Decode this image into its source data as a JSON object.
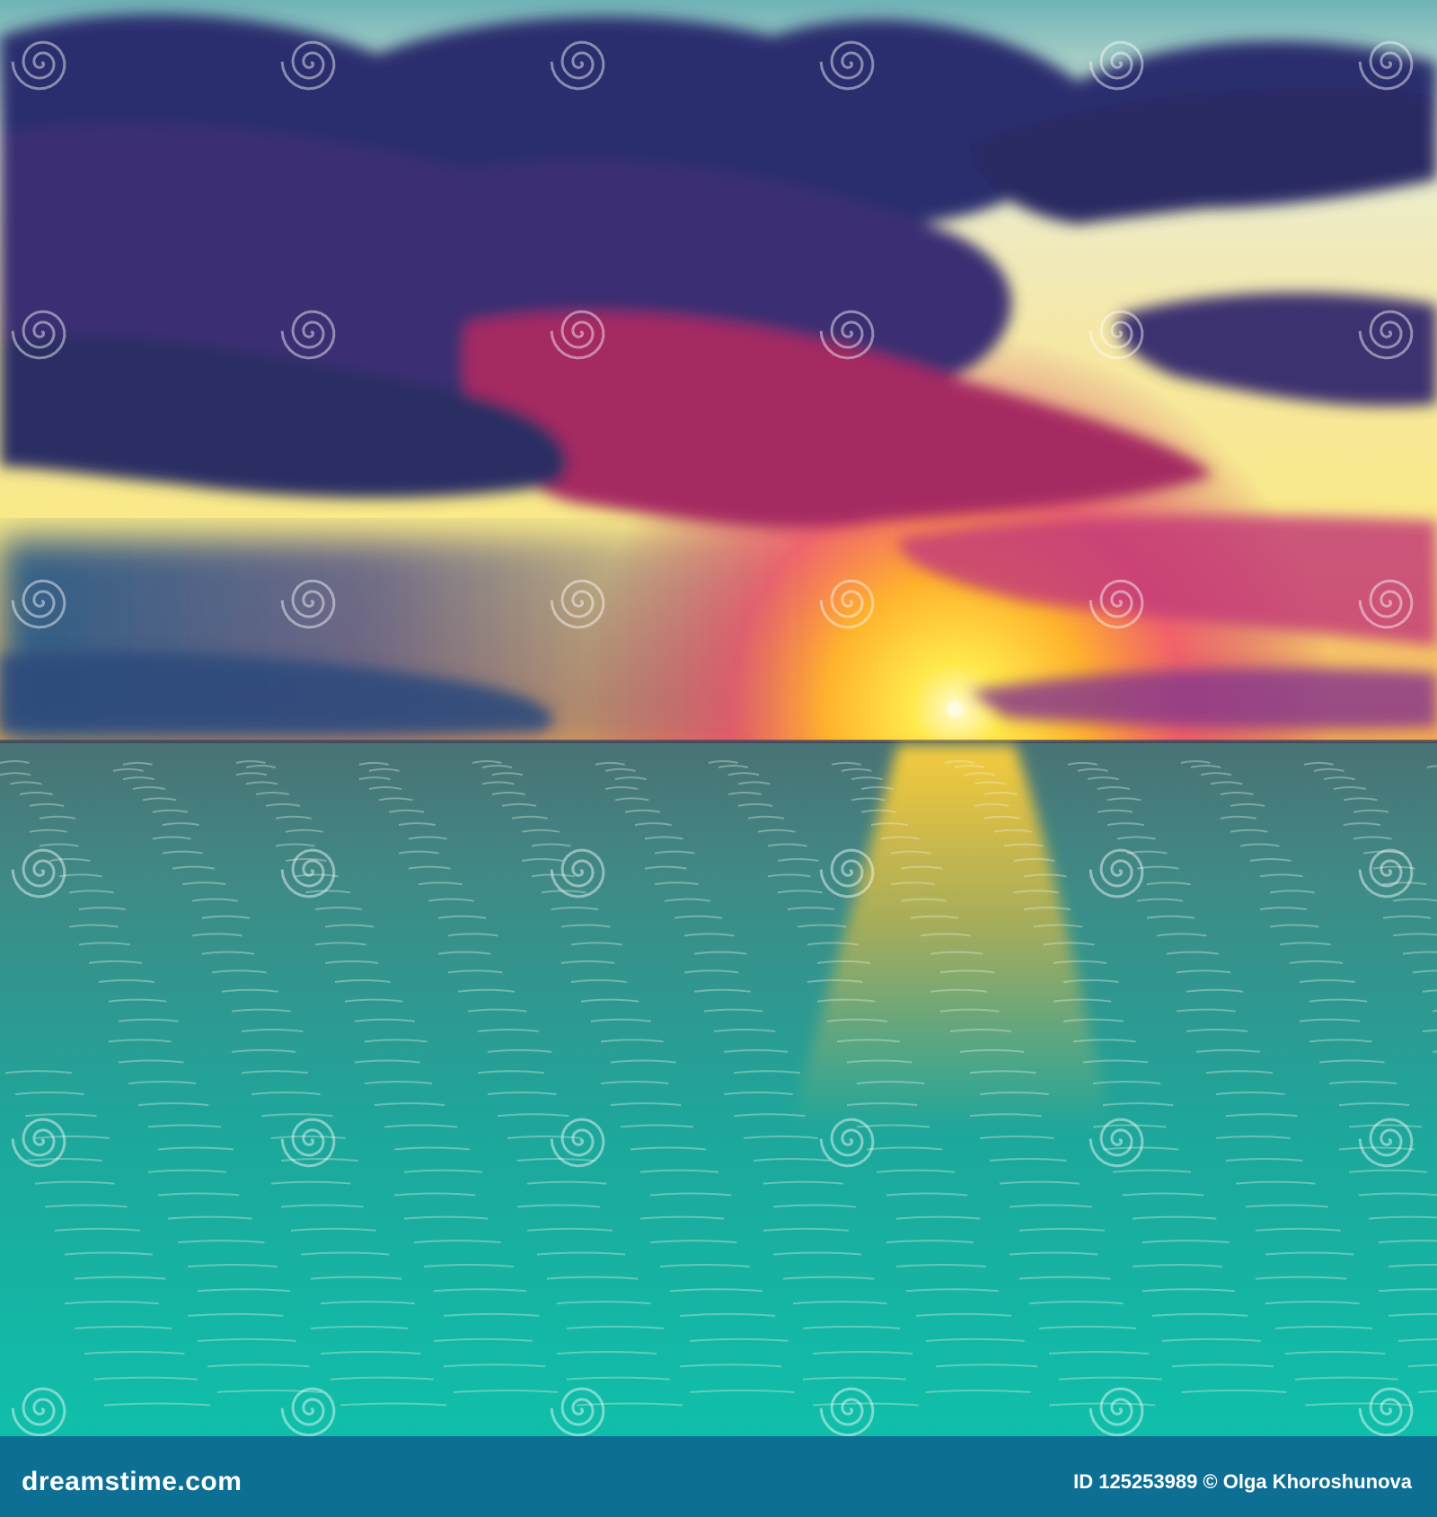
{
  "photo": {
    "alt_icon": "dreamstime-spiral-icon",
    "watermark_text": "dreamstime",
    "colors": {
      "sky_top": "#3b4a78",
      "sky_glow": "#f7e98a",
      "sun": "#ffef5a",
      "cloud_dark": "#2b2a66",
      "cloud_magenta": "#b4205a",
      "sea_far": "#3c6f78",
      "sea_near": "#0fb9a8"
    }
  },
  "footer": {
    "site": "dreamstime.com",
    "credit": "ID 125253989 © Olga Khoroshunova"
  }
}
